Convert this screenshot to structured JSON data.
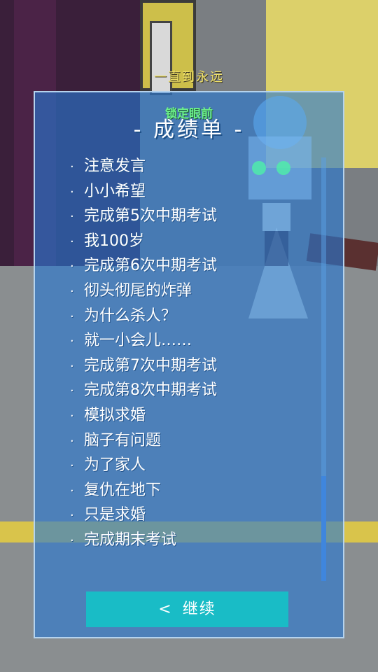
{
  "top_caption": "一直到永远",
  "panel": {
    "subtitle": "锁定眼前",
    "title": "- 成绩单 -",
    "items": [
      "注意发言",
      "小小希望",
      "完成第5次中期考试",
      "我100岁",
      "完成第6次中期考试",
      "彻头彻尾的炸弹",
      "为什么杀人？",
      "就一小会儿……",
      "完成第7次中期考试",
      "完成第8次中期考试",
      "模拟求婚",
      "脑子有问题",
      "为了家人",
      "复仇在地下",
      "只是求婚",
      "完成期末考试"
    ],
    "bullet": "·",
    "scroll_position": 0.75
  },
  "continue_button": {
    "icon": "<",
    "label": "继续"
  },
  "colors": {
    "panel_bg": "#2878d2",
    "button_bg": "#19bcc6",
    "subtitle": "#6cf08a",
    "caption": "#f2e36a"
  }
}
